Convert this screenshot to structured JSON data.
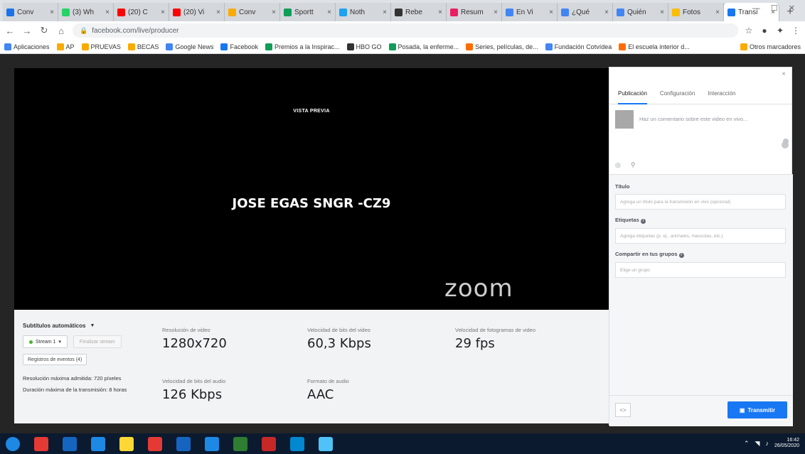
{
  "browser": {
    "tabs": [
      {
        "label": "Conv",
        "color": "#1a73e8"
      },
      {
        "label": "(3) Wh",
        "color": "#25d366"
      },
      {
        "label": "(20) C",
        "color": "#ff0000"
      },
      {
        "label": "(20) Vi",
        "color": "#ff0000"
      },
      {
        "label": "Conv",
        "color": "#f9ab00"
      },
      {
        "label": "Sportt",
        "color": "#0f9d58"
      },
      {
        "label": "Noth",
        "color": "#1da1f2"
      },
      {
        "label": "Rebe",
        "color": "#333333"
      },
      {
        "label": "Resum",
        "color": "#e91e63"
      },
      {
        "label": "En Vi",
        "color": "#4285f4"
      },
      {
        "label": "¿Qué",
        "color": "#4285f4"
      },
      {
        "label": "Quién",
        "color": "#4285f4"
      },
      {
        "label": "Fotos",
        "color": "#fbbc04"
      },
      {
        "label": "Transi",
        "color": "#1877f2",
        "active": true
      }
    ],
    "new_tab": "+",
    "window_controls": "— ☐ ✕",
    "url": "facebook.com/live/producer",
    "bookmarks": [
      {
        "label": "Aplicaciones",
        "color": "#4285f4"
      },
      {
        "label": "AP",
        "color": "#f9ab00"
      },
      {
        "label": "PRUEVAS",
        "color": "#f9ab00"
      },
      {
        "label": "BECAS",
        "color": "#f9ab00"
      },
      {
        "label": "Google News",
        "color": "#4285f4"
      },
      {
        "label": "Facebook",
        "color": "#1877f2"
      },
      {
        "label": "Premios a la Inspirac...",
        "color": "#0f9d58"
      },
      {
        "label": "HBO GO",
        "color": "#333333"
      },
      {
        "label": "Posada, la enferme...",
        "color": "#0f9d58"
      },
      {
        "label": "Series, películas, de...",
        "color": "#ff6d00"
      },
      {
        "label": "Fundación Cotvídea",
        "color": "#4285f4"
      },
      {
        "label": "El escuela interior d...",
        "color": "#ff6d00"
      }
    ],
    "bookmarks_other": "Otros marcadores"
  },
  "player": {
    "preview_label": "VISTA PREVIA",
    "title": "JOSE EGAS SNGR -CZ9",
    "logo": "zoom"
  },
  "stats": {
    "captions_label": "Subtítulos automáticos",
    "stream_select": "Stream 1",
    "end_button": "Finalizar stream",
    "events_button": "Registros de eventos (4)",
    "max_resolution": "Resolución máxima admitida: 720 píxeles",
    "max_duration": "Duración máxima de la transmisión: 8 horas",
    "video_resolution": {
      "label": "Resolución de video",
      "value": "1280x720"
    },
    "video_bitrate": {
      "label": "Velocidad de bits del video",
      "value": "60,3 Kbps"
    },
    "frame_rate": {
      "label": "Velocidad de fotogramas de video",
      "value": "29 fps"
    },
    "audio_bitrate": {
      "label": "Velocidad de bits del audio",
      "value": "126 Kbps"
    },
    "audio_format": {
      "label": "Formato de audio",
      "value": "AAC"
    }
  },
  "panel": {
    "close": "×",
    "tabs": [
      "Publicación",
      "Configuración",
      "Interacción"
    ],
    "comment_placeholder": "Haz un comentario sobre este video en vivo...",
    "title_label": "Título",
    "title_placeholder": "Agrega un título para la transmisión en vivo (opcional)",
    "tags_label": "Etiquetas",
    "tags_placeholder": "Agrega etiquetas (p. ej., animales, mascotas, etc.)",
    "share_label": "Compartir en tus grupos",
    "share_placeholder": "Elige un grupo",
    "footer_left": "<>",
    "go_live": "Transmitir"
  },
  "taskbar": {
    "icons": [
      "#1e88e5",
      "#e53935",
      "#1565c0",
      "#1e88e5",
      "#fdd835",
      "#e53935",
      "#1565c0",
      "#1e88e5",
      "#2e7d32",
      "#c62828",
      "#0288d1",
      "#4fc3f7"
    ],
    "time": "16:42",
    "date": "26/05/2020"
  }
}
